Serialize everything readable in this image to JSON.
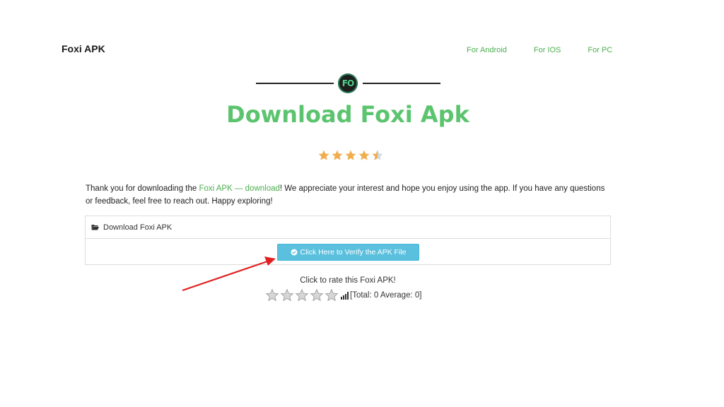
{
  "header": {
    "brand": "Foxi APK",
    "nav": [
      {
        "label": "For Android"
      },
      {
        "label": "For IOS"
      },
      {
        "label": "For PC"
      }
    ]
  },
  "logo": {
    "text": "FO",
    "icon": "foxi-logo-icon"
  },
  "page_title": "Download Foxi Apk",
  "top_rating": {
    "value": 4.5,
    "max": 5,
    "color": "#f0ad4e"
  },
  "intro": {
    "before_link": "Thank you for downloading the ",
    "link_text": "Foxi APK — download",
    "after_link": "! We appreciate your interest and hope you enjoy using the app. If you have any questions or feedback, feel free to reach out. Happy exploring!"
  },
  "download_panel": {
    "heading": "Download Foxi APK",
    "heading_icon": "folder-open-icon",
    "verify_button": "Click Here to Verify the APK File",
    "verify_icon": "check-circle-icon"
  },
  "user_rating": {
    "prompt": "Click to rate this Foxi APK!",
    "stars": 5,
    "stats": "[Total: 0 Average: 0]",
    "stats_icon": "bar-chart-icon"
  },
  "colors": {
    "accent_green": "#5cc46f",
    "link_green": "#4caf50",
    "button_blue": "#5bc0de",
    "arrow_red": "#e02020"
  }
}
